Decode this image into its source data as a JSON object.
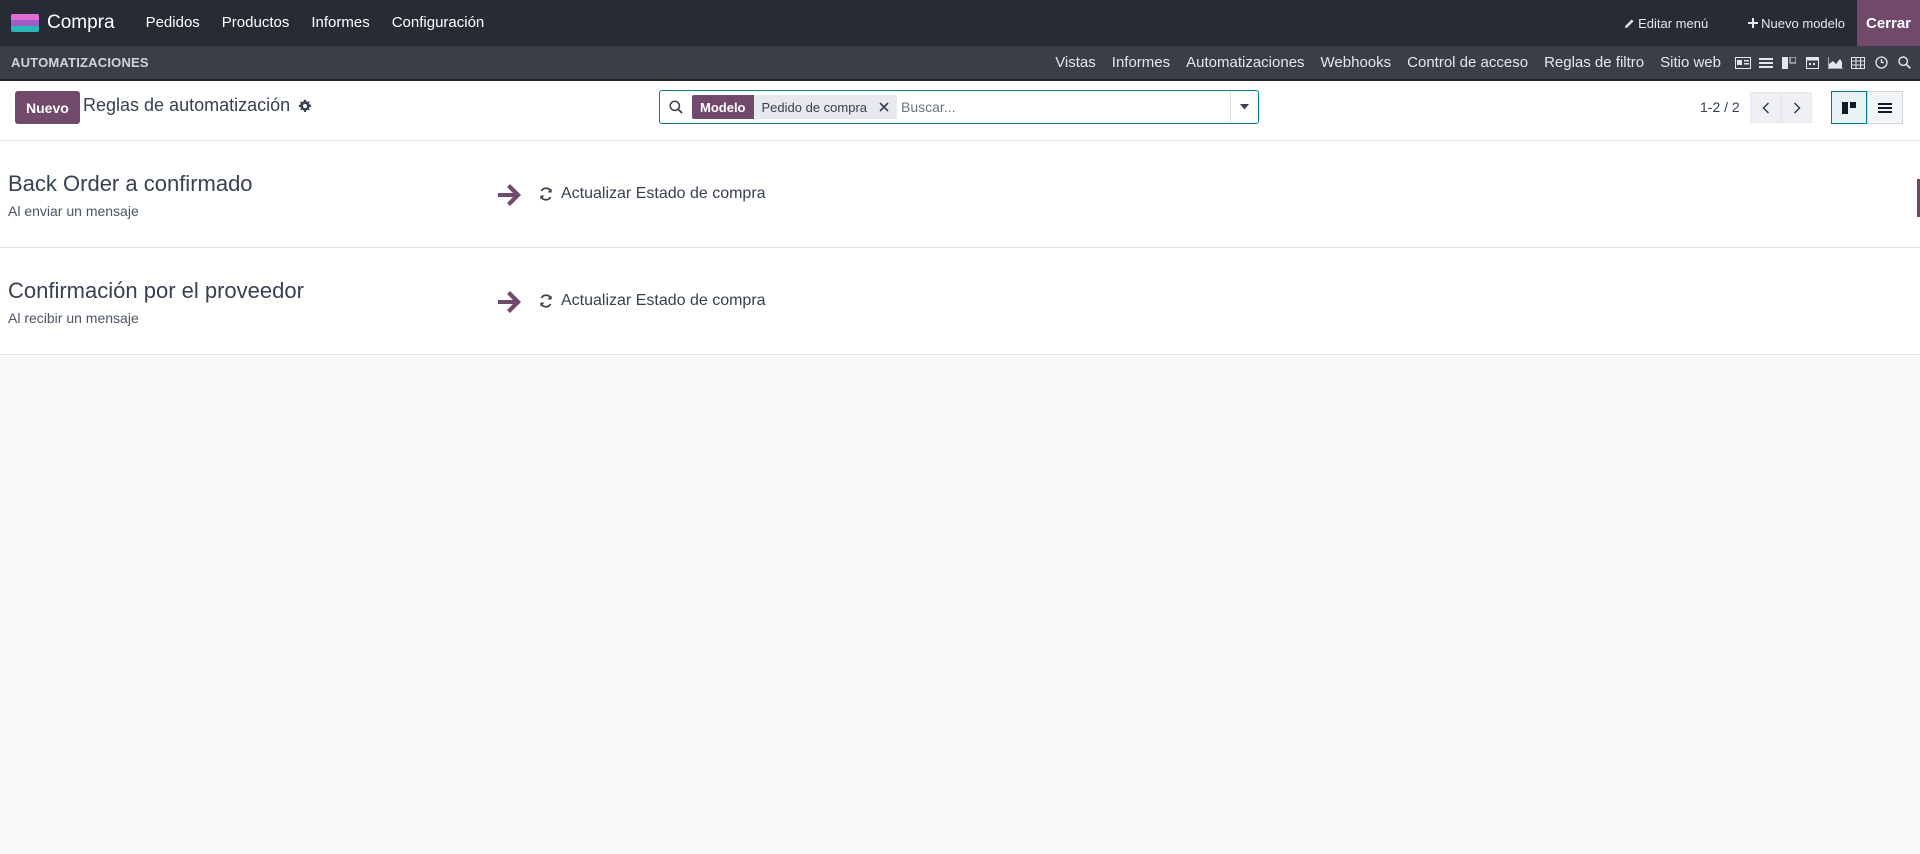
{
  "navbar": {
    "app_name": "Compra",
    "menu": [
      "Pedidos",
      "Productos",
      "Informes",
      "Configuración"
    ],
    "edit_menu": "Editar menú",
    "new_model": "Nuevo modelo",
    "close": "Cerrar"
  },
  "studio_bar": {
    "title": "AUTOMATIZACIONES",
    "menu": [
      "Vistas",
      "Informes",
      "Automatizaciones",
      "Webhooks",
      "Control de acceso",
      "Reglas de filtro",
      "Sitio web"
    ],
    "view_icons": [
      "form-view-icon",
      "list-view-icon",
      "kanban-view-icon",
      "calendar-view-icon",
      "graph-view-icon",
      "pivot-view-icon",
      "activity-view-icon",
      "search-view-icon"
    ]
  },
  "control": {
    "new_button": "Nuevo",
    "breadcrumb": "Reglas de automatización",
    "search": {
      "facet_label": "Modelo",
      "facet_value": "Pedido de compra",
      "placeholder": "Buscar..."
    },
    "pager": "1-2 / 2"
  },
  "records": [
    {
      "title": "Back Order a confirmado",
      "trigger": "Al enviar un mensaje",
      "action": "Actualizar Estado de compra"
    },
    {
      "title": "Confirmación por el proveedor",
      "trigger": "Al recibir un mensaje",
      "action": "Actualizar Estado de compra"
    }
  ],
  "colors": {
    "brand": "#71496a",
    "navbar": "#262b35",
    "subbar": "#3a3e48",
    "accent": "#017e84"
  }
}
